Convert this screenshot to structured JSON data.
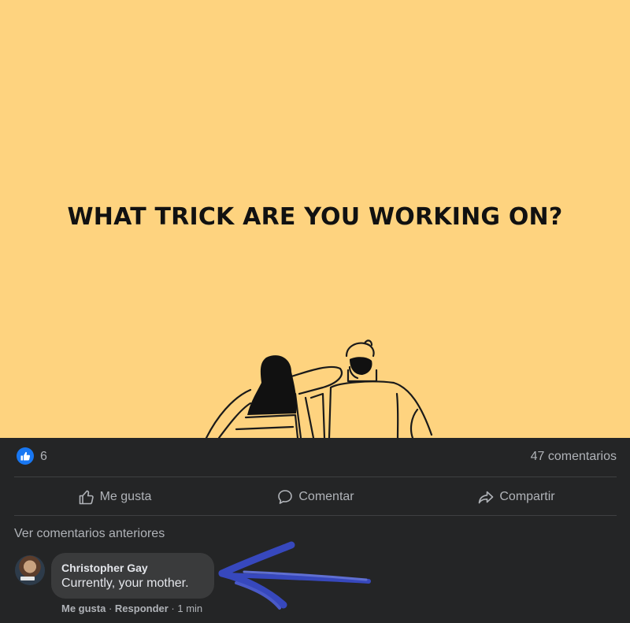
{
  "post": {
    "image_headline": "WHAT TRICK ARE YOU WORKING ON?",
    "background_color": "#fed37f"
  },
  "stats": {
    "like_count": "6",
    "comment_count": "47 comentarios"
  },
  "actions": {
    "like_label": "Me gusta",
    "comment_label": "Comentar",
    "share_label": "Compartir"
  },
  "comments": {
    "view_previous": "Ver comentarios anteriores",
    "items": [
      {
        "author": "Christopher Gay",
        "text": "Currently, your mother.",
        "like_label": "Me gusta",
        "reply_label": "Responder",
        "time": "1 min"
      }
    ]
  },
  "theme": {
    "panel_bg": "#242526",
    "bubble_bg": "#3a3b3c",
    "accent": "#1877f2",
    "scribble_color": "#3b4fd8"
  }
}
